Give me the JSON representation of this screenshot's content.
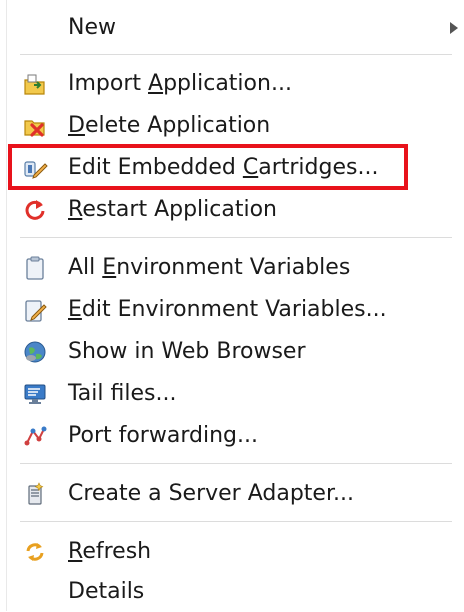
{
  "menu": {
    "new": {
      "label": "New"
    },
    "items": [
      {
        "pre": "Import ",
        "acc": "A",
        "post": "pplication...",
        "icon": "import-application-icon"
      },
      {
        "pre": "",
        "acc": "D",
        "post": "elete Application",
        "icon": "delete-application-icon"
      },
      {
        "pre": "Edit Embedded ",
        "acc": "C",
        "post": "artridges...",
        "icon": "edit-cartridges-icon"
      },
      {
        "pre": "",
        "acc": "R",
        "post": "estart Application",
        "icon": "restart-icon"
      },
      {
        "pre": "All ",
        "acc": "E",
        "post": "nvironment Variables",
        "icon": "clipboard-icon"
      },
      {
        "pre": "",
        "acc": "E",
        "post": "dit Environment Variables...",
        "icon": "edit-clipboard-icon"
      },
      {
        "pre": "Show in Web Browser",
        "acc": "",
        "post": "",
        "icon": "globe-icon"
      },
      {
        "pre": "Tail files...",
        "acc": "",
        "post": "",
        "icon": "monitor-icon"
      },
      {
        "pre": "Port forwarding...",
        "acc": "",
        "post": "",
        "icon": "port-forwarding-icon"
      },
      {
        "pre": "Create a Server Adapter...",
        "acc": "",
        "post": "",
        "icon": "server-adapter-icon"
      },
      {
        "pre": "",
        "acc": "R",
        "post": "efresh",
        "icon": "refresh-icon"
      },
      {
        "pre": "Details",
        "acc": "",
        "post": "",
        "icon": ""
      }
    ]
  },
  "colors": {
    "highlight": "#e8121b",
    "text": "#1a1a1a"
  }
}
